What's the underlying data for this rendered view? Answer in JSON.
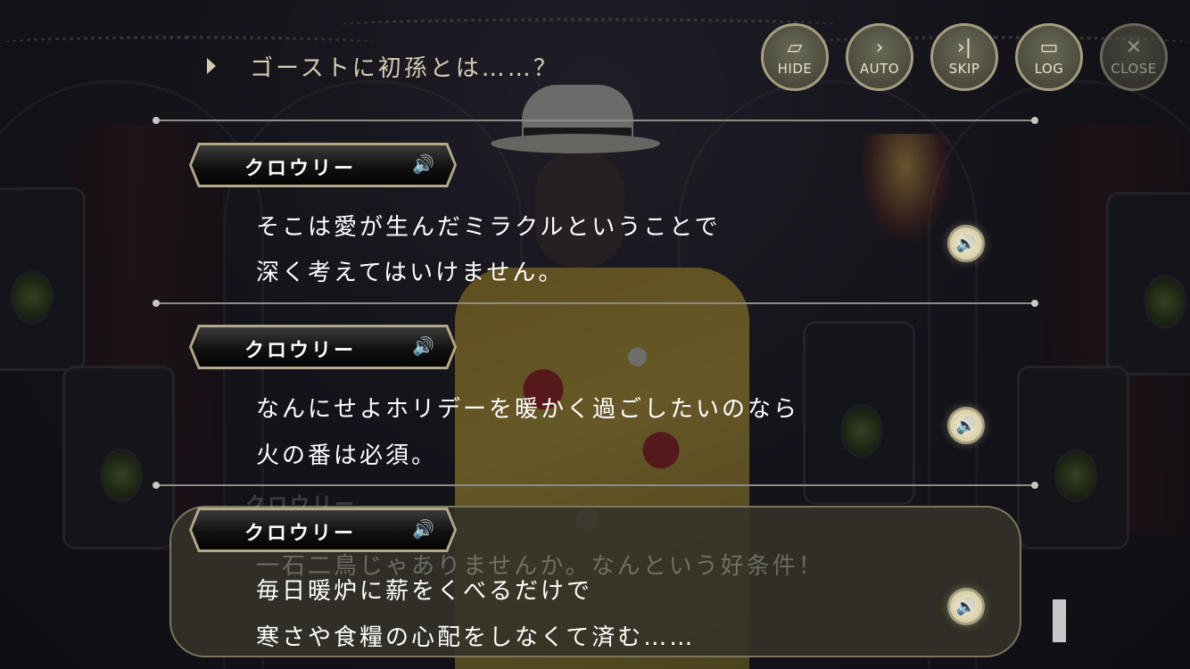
{
  "header": {
    "title": "ゴーストに初孫とは……？"
  },
  "controls": [
    {
      "label": "HIDE",
      "icon": "hide-icon",
      "symbol": "▱"
    },
    {
      "label": "AUTO",
      "icon": "auto-icon",
      "symbol": "›"
    },
    {
      "label": "SKIP",
      "icon": "skip-icon",
      "symbol": "›|"
    },
    {
      "label": "LOG",
      "icon": "log-icon",
      "symbol": "▭"
    },
    {
      "label": "CLOSE",
      "icon": "close-icon",
      "symbol": "✕"
    }
  ],
  "log": [
    {
      "speaker": "クロウリー",
      "lines": [
        "そこは愛が生んだミラクルということで",
        "深く考えてはいけません。"
      ]
    },
    {
      "speaker": "クロウリー",
      "lines": [
        "なんにせよホリデーを暖かく過ごしたいのなら",
        "火の番は必須。"
      ]
    }
  ],
  "ghost": {
    "speaker": "クロウリー",
    "line": "一石二鳥じゃありませんか。なんという好条件！"
  },
  "current": {
    "speaker": "クロウリー",
    "lines": [
      "毎日暖炉に薪をくべるだけで",
      "寒さや食糧の心配をしなくて済む……"
    ]
  },
  "speaker_symbol": "🔊",
  "colors": {
    "accent_gold": "#b3a98a",
    "title_text": "#d8cdb4",
    "panel_bg": "#34322a"
  }
}
